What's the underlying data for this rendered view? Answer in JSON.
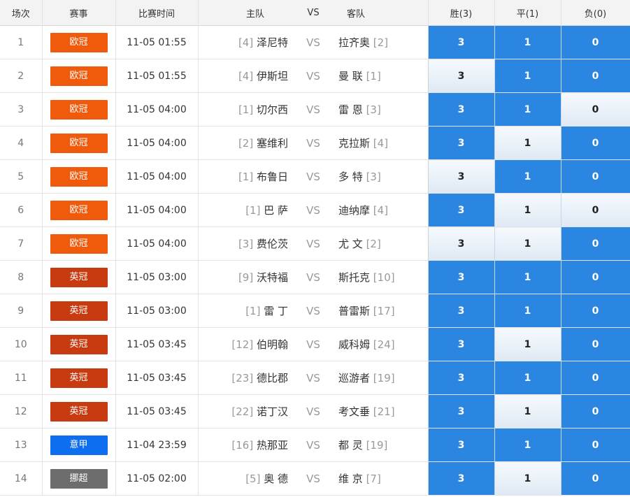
{
  "header": {
    "idx": "场次",
    "league": "赛事",
    "time": "比赛时间",
    "home": "主队",
    "vs": "VS",
    "away": "客队",
    "win": "胜(3)",
    "draw": "平(1)",
    "lose": "负(0)"
  },
  "colors": {
    "ucl": "#f05a0c",
    "uecl": "#c83a0f",
    "seriea": "#0d6ef0",
    "norway": "#6d6d6d",
    "selected": "#2a86e0"
  },
  "matches": [
    {
      "idx": "1",
      "league": "欧冠",
      "league_color": "#f05a0c",
      "time": "11-05 01:55",
      "home_rank": "[4]",
      "home": "泽尼特",
      "vs": "VS",
      "away": "拉齐奥",
      "away_rank": "[2]",
      "win": "3",
      "draw": "1",
      "lose": "0",
      "sel": [
        true,
        true,
        true
      ]
    },
    {
      "idx": "2",
      "league": "欧冠",
      "league_color": "#f05a0c",
      "time": "11-05 01:55",
      "home_rank": "[4]",
      "home": "伊斯坦",
      "vs": "VS",
      "away": "曼 联",
      "away_rank": "[1]",
      "win": "3",
      "draw": "1",
      "lose": "0",
      "sel": [
        false,
        true,
        true
      ]
    },
    {
      "idx": "3",
      "league": "欧冠",
      "league_color": "#f05a0c",
      "time": "11-05 04:00",
      "home_rank": "[1]",
      "home": "切尔西",
      "vs": "VS",
      "away": "雷 恩",
      "away_rank": "[3]",
      "win": "3",
      "draw": "1",
      "lose": "0",
      "sel": [
        true,
        true,
        false
      ]
    },
    {
      "idx": "4",
      "league": "欧冠",
      "league_color": "#f05a0c",
      "time": "11-05 04:00",
      "home_rank": "[2]",
      "home": "塞维利",
      "vs": "VS",
      "away": "克拉斯",
      "away_rank": "[4]",
      "win": "3",
      "draw": "1",
      "lose": "0",
      "sel": [
        true,
        false,
        true
      ]
    },
    {
      "idx": "5",
      "league": "欧冠",
      "league_color": "#f05a0c",
      "time": "11-05 04:00",
      "home_rank": "[1]",
      "home": "布鲁日",
      "vs": "VS",
      "away": "多 特",
      "away_rank": "[3]",
      "win": "3",
      "draw": "1",
      "lose": "0",
      "sel": [
        false,
        true,
        true
      ]
    },
    {
      "idx": "6",
      "league": "欧冠",
      "league_color": "#f05a0c",
      "time": "11-05 04:00",
      "home_rank": "[1]",
      "home": "巴 萨",
      "vs": "VS",
      "away": "迪纳摩",
      "away_rank": "[4]",
      "win": "3",
      "draw": "1",
      "lose": "0",
      "sel": [
        true,
        false,
        false
      ]
    },
    {
      "idx": "7",
      "league": "欧冠",
      "league_color": "#f05a0c",
      "time": "11-05 04:00",
      "home_rank": "[3]",
      "home": "费伦茨",
      "vs": "VS",
      "away": "尤 文",
      "away_rank": "[2]",
      "win": "3",
      "draw": "1",
      "lose": "0",
      "sel": [
        false,
        false,
        true
      ]
    },
    {
      "idx": "8",
      "league": "英冠",
      "league_color": "#c83a0f",
      "time": "11-05 03:00",
      "home_rank": "[9]",
      "home": "沃特福",
      "vs": "VS",
      "away": "斯托克",
      "away_rank": "[10]",
      "win": "3",
      "draw": "1",
      "lose": "0",
      "sel": [
        true,
        true,
        true
      ]
    },
    {
      "idx": "9",
      "league": "英冠",
      "league_color": "#c83a0f",
      "time": "11-05 03:00",
      "home_rank": "[1]",
      "home": "雷 丁",
      "vs": "VS",
      "away": "普雷斯",
      "away_rank": "[17]",
      "win": "3",
      "draw": "1",
      "lose": "0",
      "sel": [
        true,
        true,
        true
      ]
    },
    {
      "idx": "10",
      "league": "英冠",
      "league_color": "#c83a0f",
      "time": "11-05 03:45",
      "home_rank": "[12]",
      "home": "伯明翰",
      "vs": "VS",
      "away": "威科姆",
      "away_rank": "[24]",
      "win": "3",
      "draw": "1",
      "lose": "0",
      "sel": [
        true,
        false,
        true
      ]
    },
    {
      "idx": "11",
      "league": "英冠",
      "league_color": "#c83a0f",
      "time": "11-05 03:45",
      "home_rank": "[23]",
      "home": "德比郡",
      "vs": "VS",
      "away": "巡游者",
      "away_rank": "[19]",
      "win": "3",
      "draw": "1",
      "lose": "0",
      "sel": [
        true,
        true,
        true
      ]
    },
    {
      "idx": "12",
      "league": "英冠",
      "league_color": "#c83a0f",
      "time": "11-05 03:45",
      "home_rank": "[22]",
      "home": "诺丁汉",
      "vs": "VS",
      "away": "考文垂",
      "away_rank": "[21]",
      "win": "3",
      "draw": "1",
      "lose": "0",
      "sel": [
        true,
        false,
        true
      ]
    },
    {
      "idx": "13",
      "league": "意甲",
      "league_color": "#0d6ef0",
      "time": "11-04 23:59",
      "home_rank": "[16]",
      "home": "热那亚",
      "vs": "VS",
      "away": "都 灵",
      "away_rank": "[19]",
      "win": "3",
      "draw": "1",
      "lose": "0",
      "sel": [
        true,
        true,
        true
      ]
    },
    {
      "idx": "14",
      "league": "挪超",
      "league_color": "#6d6d6d",
      "time": "11-05 02:00",
      "home_rank": "[5]",
      "home": "奥 德",
      "vs": "VS",
      "away": "维 京",
      "away_rank": "[7]",
      "win": "3",
      "draw": "1",
      "lose": "0",
      "sel": [
        true,
        false,
        true
      ]
    }
  ]
}
